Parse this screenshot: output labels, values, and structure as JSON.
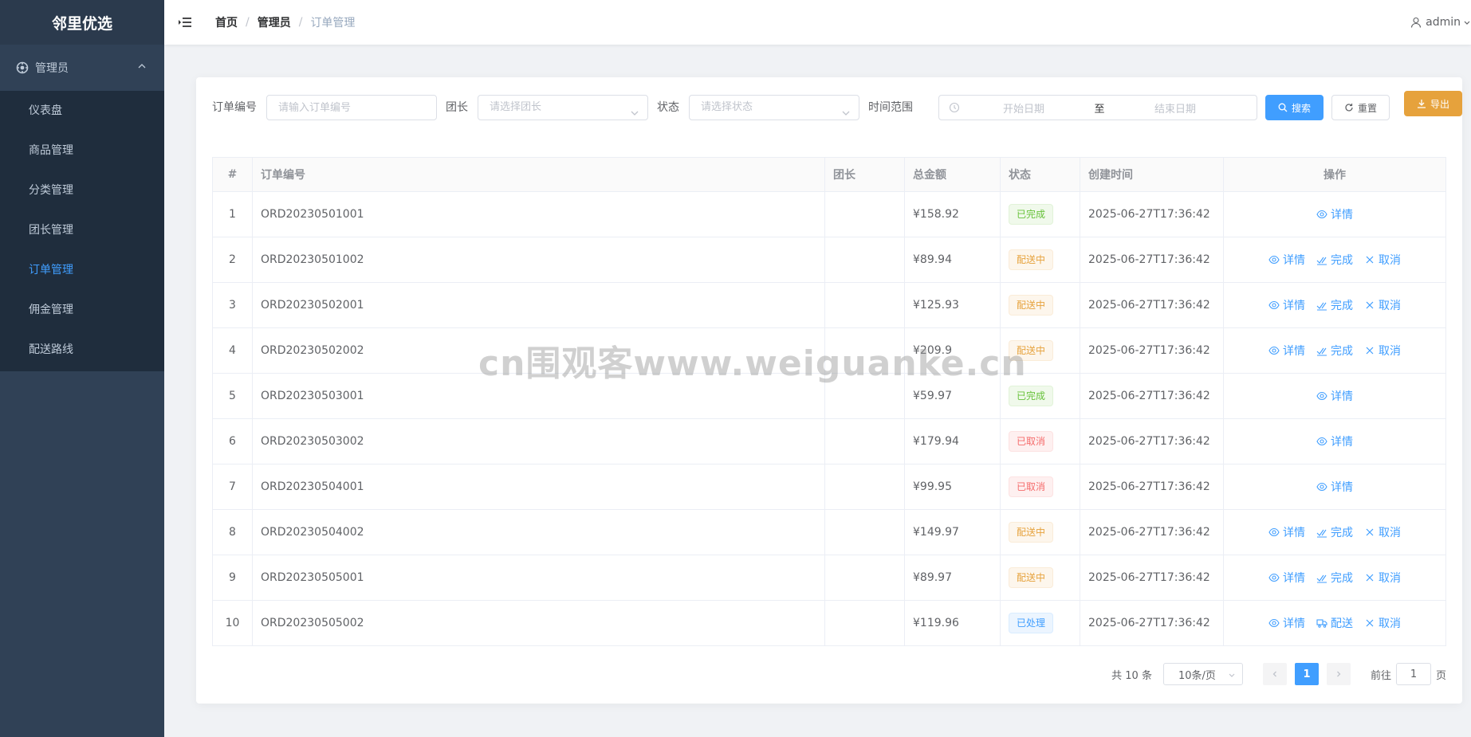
{
  "sidebar": {
    "logo": "邻里优选",
    "group": {
      "label": "管理员",
      "icon": "gear-icon",
      "expanded": true
    },
    "items": [
      {
        "label": "仪表盘",
        "active": false
      },
      {
        "label": "商品管理",
        "active": false
      },
      {
        "label": "分类管理",
        "active": false
      },
      {
        "label": "团长管理",
        "active": false
      },
      {
        "label": "订单管理",
        "active": true
      },
      {
        "label": "佣金管理",
        "active": false
      },
      {
        "label": "配送路线",
        "active": false
      }
    ]
  },
  "header": {
    "breadcrumb": [
      "首页",
      "管理员",
      "订单管理"
    ],
    "user": "admin"
  },
  "filters": {
    "order_no_label": "订单编号",
    "order_no_placeholder": "请输入订单编号",
    "leader_label": "团长",
    "leader_placeholder": "请选择团长",
    "status_label": "状态",
    "status_placeholder": "请选择状态",
    "time_label": "时间范围",
    "start_placeholder": "开始日期",
    "range_sep": "至",
    "end_placeholder": "结束日期",
    "search_label": "搜索",
    "reset_label": "重置",
    "export_label": "导出"
  },
  "table": {
    "columns": [
      "#",
      "订单编号",
      "团长",
      "总金额",
      "状态",
      "创建时间",
      "操作"
    ],
    "rows": [
      {
        "idx": "1",
        "order_no": "ORD20230501001",
        "leader": "",
        "amount": "¥158.92",
        "status": "已完成",
        "status_type": "success",
        "created": "2025-06-27T17:36:42",
        "ops": [
          "详情"
        ]
      },
      {
        "idx": "2",
        "order_no": "ORD20230501002",
        "leader": "",
        "amount": "¥89.94",
        "status": "配送中",
        "status_type": "warning",
        "created": "2025-06-27T17:36:42",
        "ops": [
          "详情",
          "完成",
          "取消"
        ]
      },
      {
        "idx": "3",
        "order_no": "ORD20230502001",
        "leader": "",
        "amount": "¥125.93",
        "status": "配送中",
        "status_type": "warning",
        "created": "2025-06-27T17:36:42",
        "ops": [
          "详情",
          "完成",
          "取消"
        ]
      },
      {
        "idx": "4",
        "order_no": "ORD20230502002",
        "leader": "",
        "amount": "¥209.9",
        "status": "配送中",
        "status_type": "warning",
        "created": "2025-06-27T17:36:42",
        "ops": [
          "详情",
          "完成",
          "取消"
        ]
      },
      {
        "idx": "5",
        "order_no": "ORD20230503001",
        "leader": "",
        "amount": "¥59.97",
        "status": "已完成",
        "status_type": "success",
        "created": "2025-06-27T17:36:42",
        "ops": [
          "详情"
        ]
      },
      {
        "idx": "6",
        "order_no": "ORD20230503002",
        "leader": "",
        "amount": "¥179.94",
        "status": "已取消",
        "status_type": "danger",
        "created": "2025-06-27T17:36:42",
        "ops": [
          "详情"
        ]
      },
      {
        "idx": "7",
        "order_no": "ORD20230504001",
        "leader": "",
        "amount": "¥99.95",
        "status": "已取消",
        "status_type": "danger",
        "created": "2025-06-27T17:36:42",
        "ops": [
          "详情"
        ]
      },
      {
        "idx": "8",
        "order_no": "ORD20230504002",
        "leader": "",
        "amount": "¥149.97",
        "status": "配送中",
        "status_type": "warning",
        "created": "2025-06-27T17:36:42",
        "ops": [
          "详情",
          "完成",
          "取消"
        ]
      },
      {
        "idx": "9",
        "order_no": "ORD20230505001",
        "leader": "",
        "amount": "¥89.97",
        "status": "配送中",
        "status_type": "warning",
        "created": "2025-06-27T17:36:42",
        "ops": [
          "详情",
          "完成",
          "取消"
        ]
      },
      {
        "idx": "10",
        "order_no": "ORD20230505002",
        "leader": "",
        "amount": "¥119.96",
        "status": "已处理",
        "status_type": "info",
        "created": "2025-06-27T17:36:42",
        "ops": [
          "详情",
          "配送",
          "取消"
        ]
      }
    ]
  },
  "pagination": {
    "total": "共 10 条",
    "page_size": "10条/页",
    "current_page": "1",
    "goto_label": "前往",
    "goto_value": "1",
    "page_suffix": "页"
  },
  "watermark": "cn围观客www.weiguanke.cn",
  "colors": {
    "sidebar_bg": "#304156",
    "accent": "#409eff",
    "success": "#67c23a",
    "warning": "#e6a23c",
    "danger": "#f56c6c"
  }
}
